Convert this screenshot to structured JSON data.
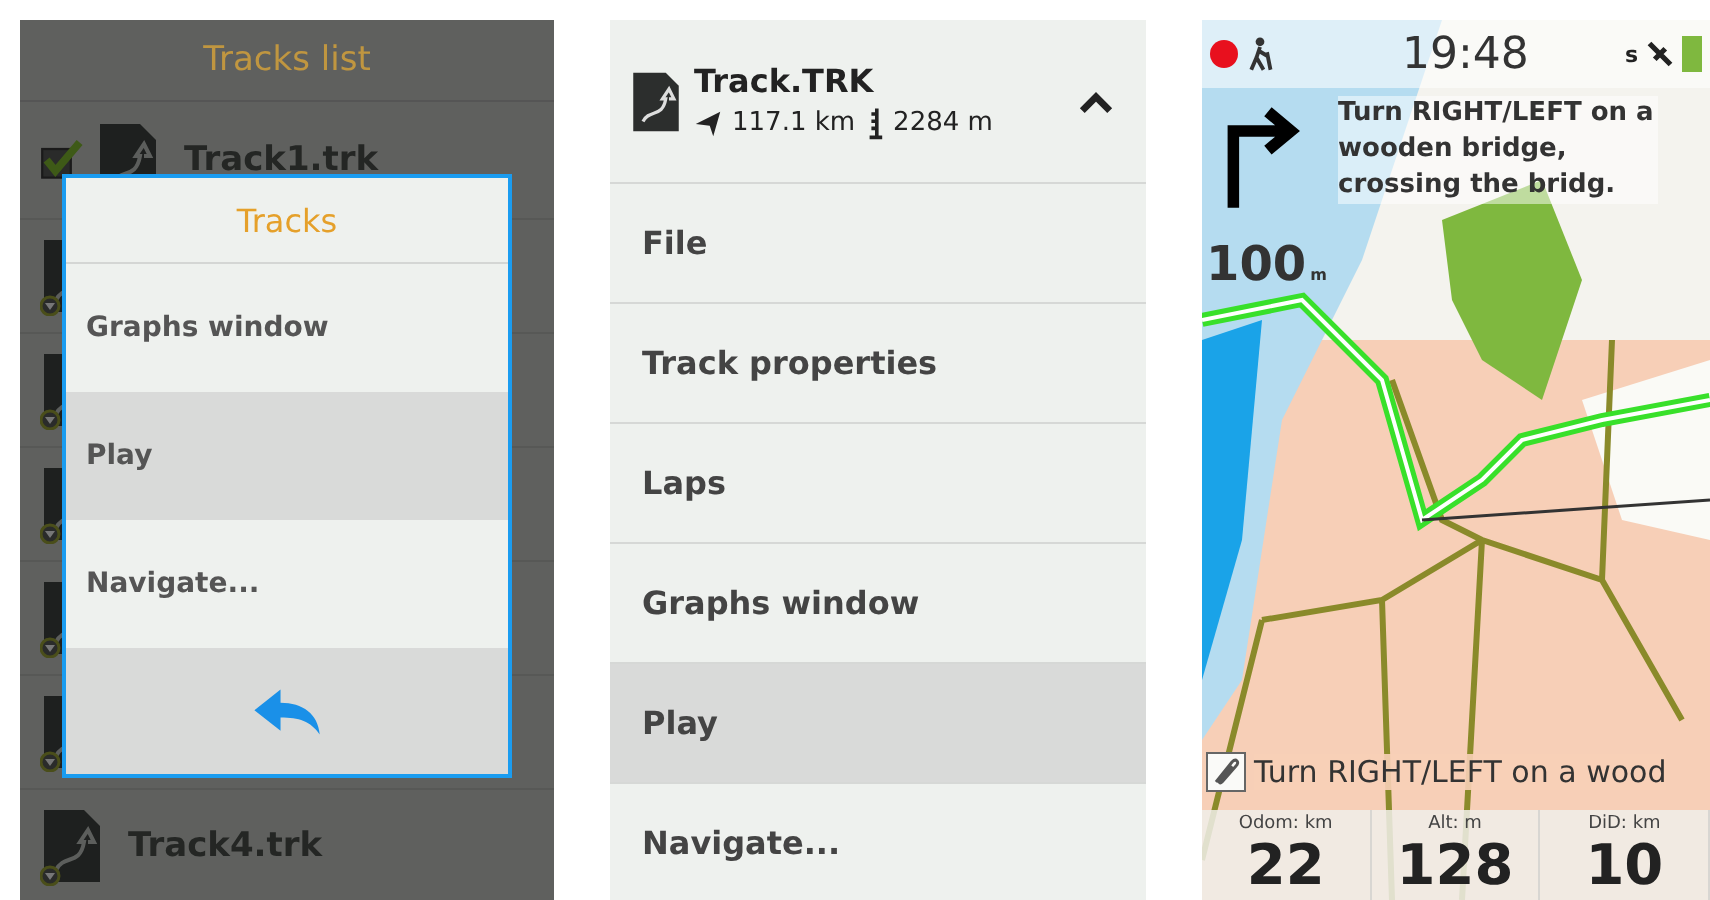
{
  "tracks_list": {
    "title": "Tracks list",
    "rows": [
      {
        "name": "Track1.trk",
        "checked": true
      },
      {
        "checked": false
      },
      {
        "checked": false
      },
      {
        "checked": false
      },
      {
        "checked": false
      },
      {
        "checked": false
      },
      {
        "name": "Track4.trk",
        "checked": false
      }
    ]
  },
  "dialog": {
    "title": "Tracks",
    "items": [
      {
        "label": "Graphs window",
        "selected": false
      },
      {
        "label": "Play",
        "selected": true
      },
      {
        "label": "Navigate...",
        "selected": false
      }
    ]
  },
  "track_menu": {
    "title": "Track.TRK",
    "distance": "117.1 km",
    "elevation": "2284 m",
    "expanded": true,
    "items": [
      {
        "label": "File",
        "selected": false
      },
      {
        "label": "Track properties",
        "selected": false
      },
      {
        "label": "Laps",
        "selected": false
      },
      {
        "label": "Graphs window",
        "selected": false
      },
      {
        "label": "Play",
        "selected": true
      },
      {
        "label": "Navigate...",
        "selected": false
      }
    ]
  },
  "navigation": {
    "recording": true,
    "time": "19:48",
    "gps_label": "s",
    "instruction": "Turn RIGHT/LEFT on a wooden bridge, crossing the bridg.",
    "distance": "100",
    "distance_unit": "m",
    "banner": "Turn RIGHT/LEFT on a wood",
    "fields": [
      {
        "label": "Odom: km",
        "value": "22"
      },
      {
        "label": "Alt: m",
        "value": "128"
      },
      {
        "label": "DiD: km",
        "value": "10"
      }
    ]
  }
}
